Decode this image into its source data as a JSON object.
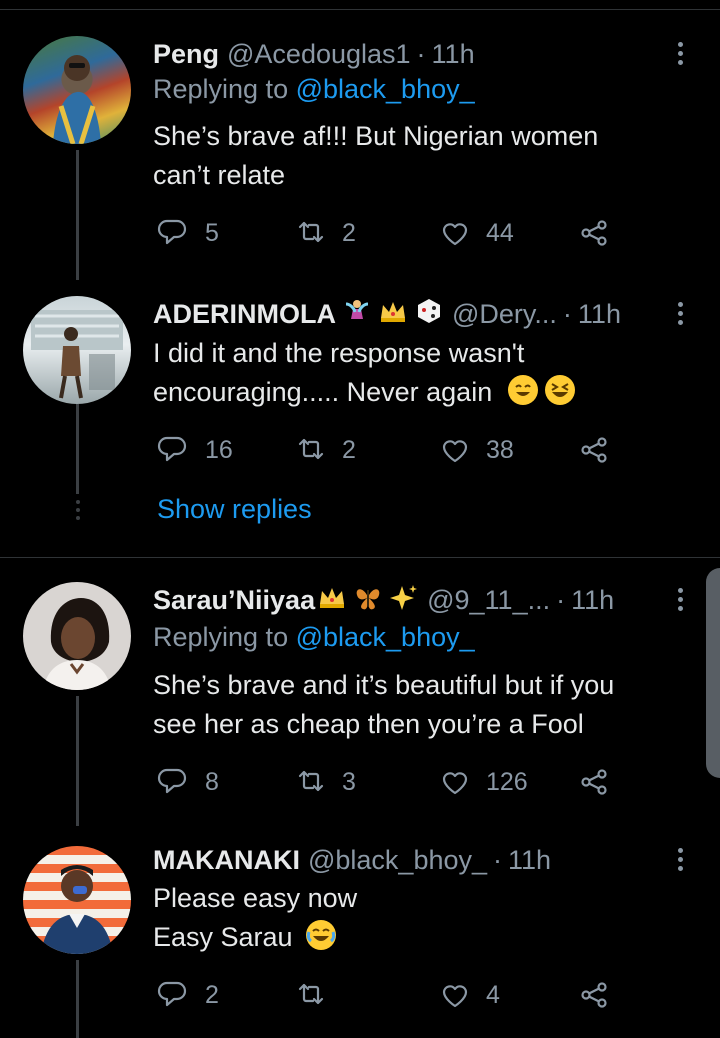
{
  "tweets": [
    {
      "name": "Peng",
      "handle": "@Acedouglas1",
      "time": "11h",
      "replying_prefix": "Replying to ",
      "replying_to": "@black_bhoy_",
      "text_lines": [
        "She’s brave af!!! But Nigerian women",
        "can’t relate"
      ],
      "replies": "5",
      "retweets": "2",
      "likes": "44"
    },
    {
      "name": "ADERINMOLA",
      "name_emojis": [
        "fairy",
        "crown",
        "game-die"
      ],
      "handle": "@Dery...",
      "time": "11h",
      "text_lines": [
        "I did it and the response wasn't",
        "encouraging..... Never again"
      ],
      "replies": "16",
      "retweets": "2",
      "likes": "38",
      "show_replies": "Show replies"
    },
    {
      "name": "Sarau’Niiyaa",
      "name_emojis": [
        "crown",
        "butterfly",
        "sparkles"
      ],
      "handle": "@9_11_...",
      "time": "11h",
      "replying_prefix": "Replying to ",
      "replying_to": "@black_bhoy_",
      "text_lines": [
        "She’s brave and it’s beautiful but if you",
        "see her as cheap then you’re a Fool"
      ],
      "replies": "8",
      "retweets": "3",
      "likes": "126"
    },
    {
      "name": "MAKANAKI",
      "handle": "@black_bhoy_",
      "time": "11h",
      "text_lines": [
        "Please easy now",
        "Easy Sarau"
      ],
      "replies": "2",
      "retweets": "",
      "likes": "4"
    }
  ],
  "icons": {
    "reply": "reply-icon",
    "retweet": "retweet-icon",
    "like": "heart-icon",
    "share": "share-icon",
    "more": "more-vertical-icon"
  },
  "colors": {
    "background": "#000000",
    "text": "#e7e9ea",
    "muted": "#8b98a5",
    "link": "#1d9bf0"
  }
}
